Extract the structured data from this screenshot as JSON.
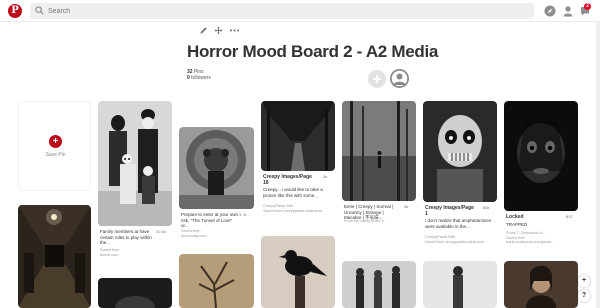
{
  "header": {
    "search_placeholder": "Search",
    "notification_count": "2"
  },
  "board": {
    "title": "Horror Mood Board 2 - A2 Media",
    "pins_count": "32",
    "pins_label": "Pins",
    "followers_count": "0",
    "followers_label": "followers"
  },
  "save_card": {
    "label": "Save Pin"
  },
  "pins": [
    {
      "title": "",
      "description": "Family members at have certain roles to play within the...",
      "saves": "10.5k",
      "source_line1": "Saved from",
      "source_line2": "tumblr.com"
    },
    {
      "title": "",
      "description": "Prepare to enter at your own risk. \"The Tunnel of Love\" or...",
      "saves": "3.7k",
      "source_line1": "Saved from",
      "source_line2": "dumpaday.com"
    },
    {
      "title": "Creepy Images/Page 18",
      "description": "Creepy... i would like to take a picture like this with some...",
      "saves": "3k",
      "source_line1": "CreepyPasta Wiki",
      "source_line2": "Saved from creepypasta.wikia.com"
    },
    {
      "title": "",
      "description": "Eerie | Creepy | Surreal | Uncanny | Strange | Macabre | 不気味...",
      "saves": "4k",
      "source_line1": "From the valley to the e...",
      "source_line2": ""
    },
    {
      "title": "Creepy Images/Page 1",
      "description": "I don't realize that amphetamines were available in the...",
      "saves": "86k",
      "source_line1": "CreepyPasta Wiki",
      "source_line2": "Saved from creepypasta.wikia.com"
    },
    {
      "title": "Locked",
      "description": "TRAPPED.",
      "saves": "837",
      "source_line1": "Saved from",
      "source_line2": "frankrozdlaczka.wordpress..."
    }
  ],
  "pin_source_prefix": "Frank T. Zumbachs M..."
}
